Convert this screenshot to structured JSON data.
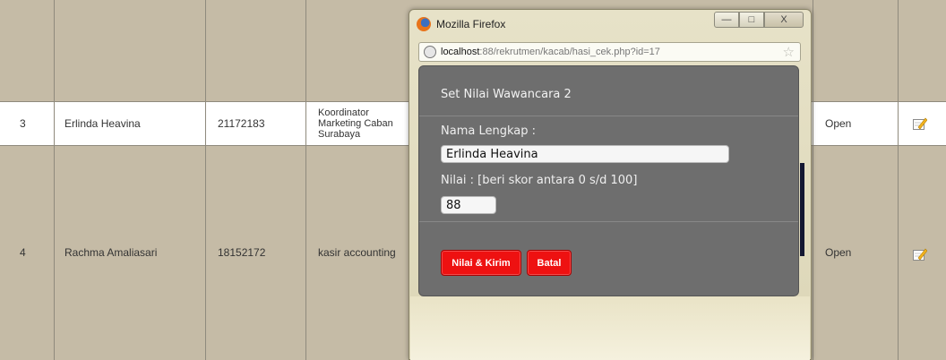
{
  "table": {
    "rows": [
      {
        "no": "3",
        "name": "Erlinda Heavina",
        "id": "21172183",
        "position": [
          "Koordinator",
          "Marketing Caban",
          "Surabaya"
        ],
        "status": "Open"
      },
      {
        "no": "4",
        "name": "Rachma Amaliasari",
        "id": "18152172",
        "position": [
          "kasir accounting"
        ],
        "status": "Open"
      }
    ],
    "icon": "edit-icon"
  },
  "browser": {
    "title": "Mozilla Firefox",
    "url_host": "localhost",
    "url_rest": ":88/rekrutmen/kacab/hasi_cek.php?id=17",
    "buttons": {
      "minimize": "—",
      "maximize": "□",
      "close": "X"
    }
  },
  "modal": {
    "title": "Set Nilai Wawancara 2",
    "name_label": "Nama Lengkap :",
    "name_value": "Erlinda Heavina",
    "score_label": "Nilai : [beri skor antara 0 s/d 100]",
    "score_value": "88",
    "submit_label": "Nilai & Kirim",
    "cancel_label": "Batal"
  },
  "colors": {
    "table_bg": "#c5bba6",
    "modal_bg": "#6e6e6e",
    "button_red": "#ee1111"
  }
}
